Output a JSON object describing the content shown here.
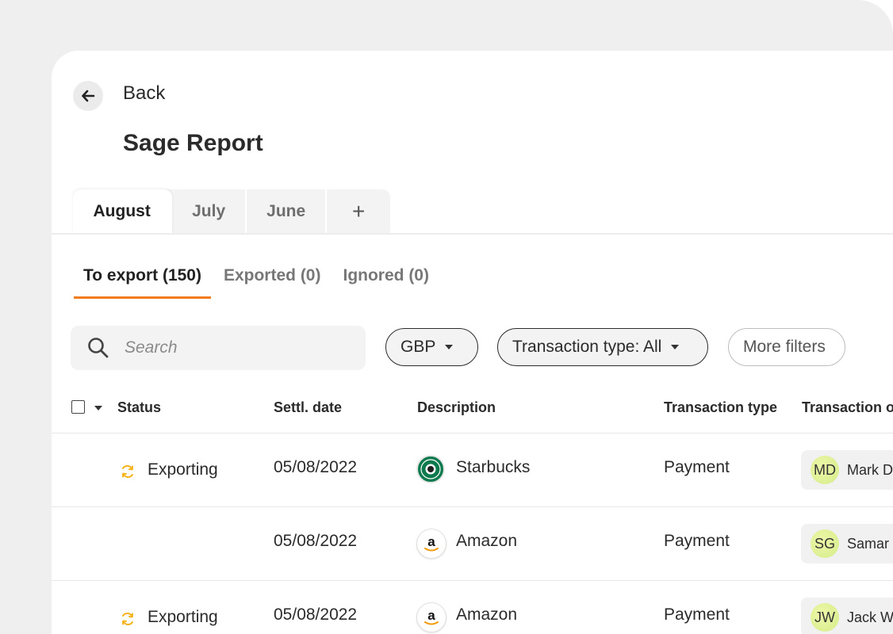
{
  "header": {
    "back_label": "Back",
    "title": "Sage Report"
  },
  "period_tabs": [
    {
      "label": "August",
      "active": true
    },
    {
      "label": "July",
      "active": false
    },
    {
      "label": "June",
      "active": false
    },
    {
      "label": "+",
      "active": false
    }
  ],
  "sub_tabs": [
    {
      "label": "To export (150)",
      "active": true
    },
    {
      "label": "Exported (0)",
      "active": false
    },
    {
      "label": "Ignored (0)",
      "active": false
    }
  ],
  "search": {
    "placeholder": "Search"
  },
  "filters": {
    "currency": "GBP",
    "transaction_type": "Transaction type: All",
    "more": "More filters"
  },
  "table": {
    "columns": [
      "Status",
      "Settl. date",
      "Description",
      "Transaction type",
      "Transaction o"
    ],
    "rows": [
      {
        "status": "Exporting",
        "date": "05/08/2022",
        "description": "Starbucks",
        "logo": "starbucks-logo",
        "type": "Payment",
        "initials": "MD",
        "owner": "Mark D"
      },
      {
        "status": "",
        "date": "05/08/2022",
        "description": "Amazon",
        "logo": "amazon-logo",
        "type": "Payment",
        "initials": "SG",
        "owner": "Samar"
      },
      {
        "status": "Exporting",
        "date": "05/08/2022",
        "description": "Amazon",
        "logo": "amazon-logo",
        "type": "Payment",
        "initials": "JW",
        "owner": "Jack W"
      }
    ]
  },
  "colors": {
    "accent": "#f07c1b",
    "status_icon": "#f5b31b",
    "avatar": "#dcef95"
  }
}
